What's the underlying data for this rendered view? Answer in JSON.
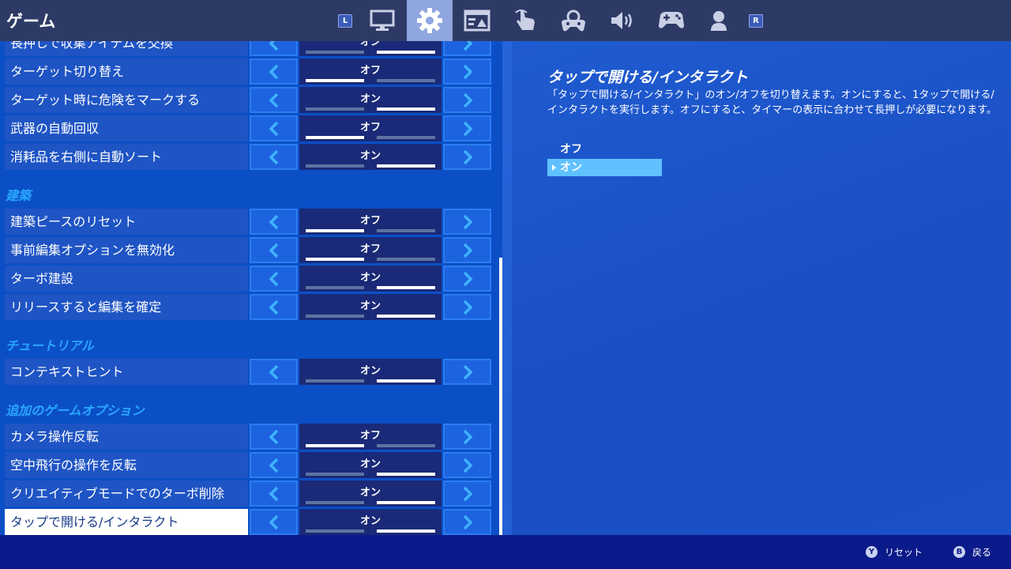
{
  "app_title": "ゲーム",
  "shoulder_left": "L",
  "shoulder_right": "R",
  "tabs": [
    {
      "icon": "monitor-icon"
    },
    {
      "icon": "gear-icon",
      "active": true
    },
    {
      "icon": "hud-layout-icon"
    },
    {
      "icon": "touch-icon"
    },
    {
      "icon": "controller-gear-icon"
    },
    {
      "icon": "speaker-icon"
    },
    {
      "icon": "gamepad-icon"
    },
    {
      "icon": "account-icon"
    }
  ],
  "settings": {
    "rows_group1": [
      {
        "label": "長押しで収集アイテムを交換",
        "value": "オン",
        "state": "on"
      },
      {
        "label": "ターゲット切り替え",
        "value": "オフ",
        "state": "off"
      },
      {
        "label": "ターゲット時に危険をマークする",
        "value": "オン",
        "state": "on"
      },
      {
        "label": "武器の自動回収",
        "value": "オフ",
        "state": "off"
      },
      {
        "label": "消耗品を右側に自動ソート",
        "value": "オン",
        "state": "on"
      }
    ],
    "section_building": "建築",
    "rows_building": [
      {
        "label": "建築ピースのリセット",
        "value": "オフ",
        "state": "off"
      },
      {
        "label": "事前編集オプションを無効化",
        "value": "オフ",
        "state": "off"
      },
      {
        "label": "ターボ建設",
        "value": "オン",
        "state": "on"
      },
      {
        "label": "リリースすると編集を確定",
        "value": "オン",
        "state": "on"
      }
    ],
    "section_tutorial": "チュートリアル",
    "rows_tutorial": [
      {
        "label": "コンテキストヒント",
        "value": "オン",
        "state": "on"
      }
    ],
    "section_extra": "追加のゲームオプション",
    "rows_extra": [
      {
        "label": "カメラ操作反転",
        "value": "オフ",
        "state": "off"
      },
      {
        "label": "空中飛行の操作を反転",
        "value": "オン",
        "state": "on"
      },
      {
        "label": "クリエイティブモードでのターボ削除",
        "value": "オン",
        "state": "on"
      },
      {
        "label": "タップで開ける/インタラクト",
        "value": "オン",
        "state": "on",
        "selected": true
      }
    ]
  },
  "detail": {
    "title": "タップで開ける/インタラクト",
    "description": "「タップで開ける/インタラクト」のオン/オフを切り替えます。オンにすると、1タップで開ける/インタラクトを実行します。オフにすると、タイマーの表示に合わせて長押しが必要になります。",
    "options": [
      "オフ",
      "オン"
    ],
    "selected_option": "オン"
  },
  "footer": {
    "reset_button": "Y",
    "reset_label": "リセット",
    "back_button": "B",
    "back_label": "戻る"
  },
  "colors": {
    "topbar": "#2e3a66",
    "panel": "#0b4fc6",
    "accent": "#2aa6ff",
    "bottombar": "#0a1a8a"
  }
}
